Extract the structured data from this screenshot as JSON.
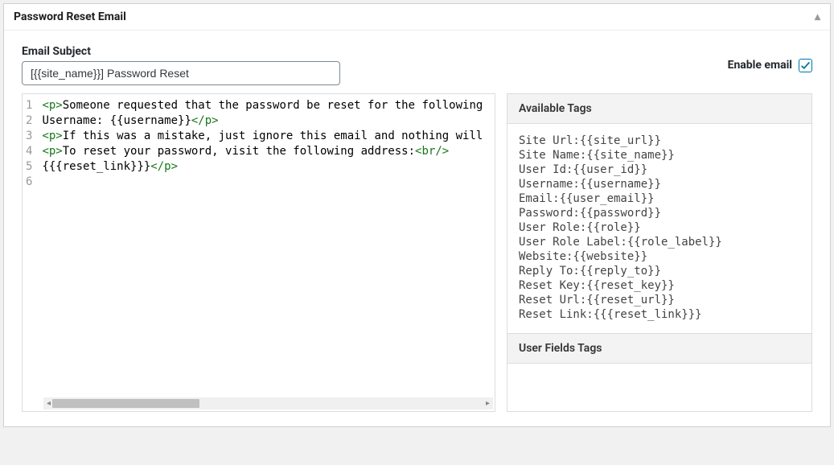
{
  "panel": {
    "title": "Password Reset Email"
  },
  "subject": {
    "label": "Email Subject",
    "value": "[{{site_name}}] Password Reset"
  },
  "enable": {
    "label": "Enable email",
    "checked": true
  },
  "editor": {
    "line_count": 6,
    "lines": [
      [
        {
          "t": "tag",
          "v": "<p>"
        },
        {
          "t": "text",
          "v": "Someone requested that the password be reset for the following"
        }
      ],
      [
        {
          "t": "text",
          "v": "Username: {{username}}"
        },
        {
          "t": "tag",
          "v": "</p>"
        }
      ],
      [
        {
          "t": "tag",
          "v": "<p>"
        },
        {
          "t": "text",
          "v": "If this was a mistake, just ignore this email and nothing will"
        }
      ],
      [
        {
          "t": "tag",
          "v": "<p>"
        },
        {
          "t": "text",
          "v": "To reset your password, visit the following address:"
        },
        {
          "t": "tag",
          "v": "<br/>"
        }
      ],
      [
        {
          "t": "text",
          "v": "{{{reset_link}}}"
        },
        {
          "t": "tag",
          "v": "</p>"
        }
      ],
      []
    ]
  },
  "sidebar": {
    "available_tags_header": "Available Tags",
    "tags": [
      "Site Url:{{site_url}}",
      "Site Name:{{site_name}}",
      "User Id:{{user_id}}",
      "Username:{{username}}",
      "Email:{{user_email}}",
      "Password:{{password}}",
      "User Role:{{role}}",
      "User Role Label:{{role_label}}",
      "Website:{{website}}",
      "Reply To:{{reply_to}}",
      "Reset Key:{{reset_key}}",
      "Reset Url:{{reset_url}}",
      "Reset Link:{{{reset_link}}}"
    ],
    "user_fields_header": "User Fields Tags"
  }
}
